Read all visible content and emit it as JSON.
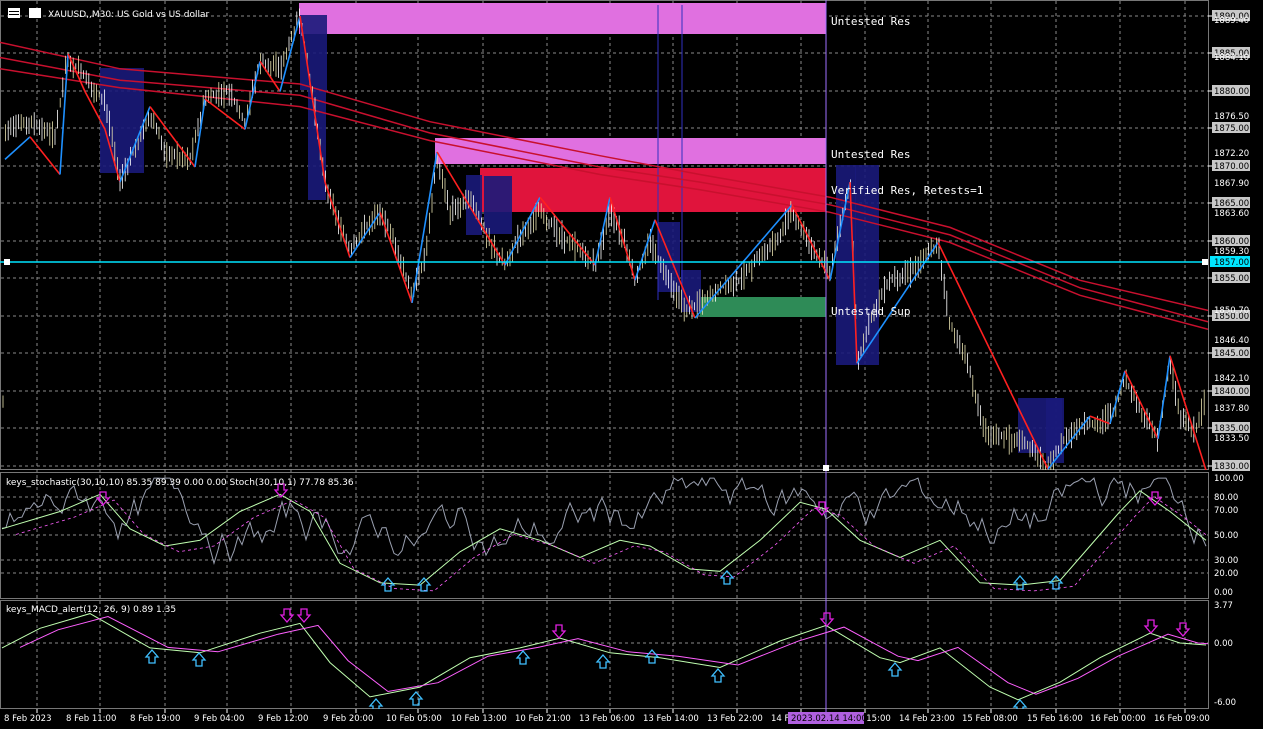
{
  "window": {
    "symbol_title": "XAUUSD,,M30: US Gold vs US dollar",
    "icon": "chart-window-icon"
  },
  "colors": {
    "background": "#000000",
    "grid": "#8a8a8a",
    "bull_candle": "#e8e2b0",
    "bear_candle": "#ffffff",
    "zigzag_up": "#1e90ff",
    "zigzag_down": "#ff2020",
    "ma_lines": "#c8102e",
    "untested_res": "#e070e0",
    "verified_res": "#e0143c",
    "untested_sup": "#2e8b57",
    "horizontal_line": "#00e5ff",
    "volume_blocks": "#1a1a7a",
    "stoch_main": "#9aa0b0",
    "stoch_signal": "#c0ffb0",
    "macd_main": "#c0ffb0",
    "macd_signal": "#ff60ff",
    "arrow_up": "#40c0ff",
    "arrow_down": "#e020e0",
    "cursor_line": "#a070ff"
  },
  "zones": [
    {
      "label": "Untested Res",
      "kind": "untested_res"
    },
    {
      "label": "Untested Res",
      "kind": "untested_res"
    },
    {
      "label": "Verified Res, Retests=1",
      "kind": "verified_res"
    },
    {
      "label": "Untested Sup",
      "kind": "untested_sup"
    }
  ],
  "price_axis": {
    "boxed_labels": [
      "1890.00",
      "1885.00",
      "1880.00",
      "1875.00",
      "1870.00",
      "1865.00",
      "1860.00",
      "1855.00",
      "1850.00",
      "1845.00",
      "1840.00",
      "1835.00",
      "1830.00"
    ],
    "plain_labels": [
      "1889.40",
      "1884.10",
      "1876.50",
      "1872.20",
      "1867.90",
      "1863.60",
      "1859.30",
      "1850.70",
      "1846.40",
      "1842.10",
      "1837.80",
      "1833.50"
    ],
    "current_price": "1857.00"
  },
  "stochastic": {
    "header": "keys_stochastic(30,10,10) 85.35 89.39 0.00 0.00 Stoch(30,10,1) 77.78 85.36",
    "levels": [
      "100.00",
      "80.00",
      "70.00",
      "50.00",
      "30.00",
      "20.00",
      "0.00"
    ]
  },
  "macd": {
    "header": "keys_MACD_alert(12, 26, 9) 0.89 1.35",
    "levels": [
      "3.77",
      "0.00",
      "-6.00"
    ]
  },
  "time_axis": {
    "labels": [
      "8 Feb 2023",
      "8 Feb 11:00",
      "8 Feb 19:00",
      "9 Feb 04:00",
      "9 Feb 12:00",
      "9 Feb 20:00",
      "10 Feb 05:00",
      "10 Feb 13:00",
      "10 Feb 21:00",
      "13 Feb 06:00",
      "13 Feb 14:00",
      "13 Feb 22:00",
      "14 Feb 06:00",
      "14 Feb 15:00",
      "14 Feb 23:00",
      "15 Feb 08:00",
      "15 Feb 16:00",
      "16 Feb 00:00",
      "16 Feb 09:00"
    ],
    "cursor_label": "2023.02.14 14:00"
  }
}
